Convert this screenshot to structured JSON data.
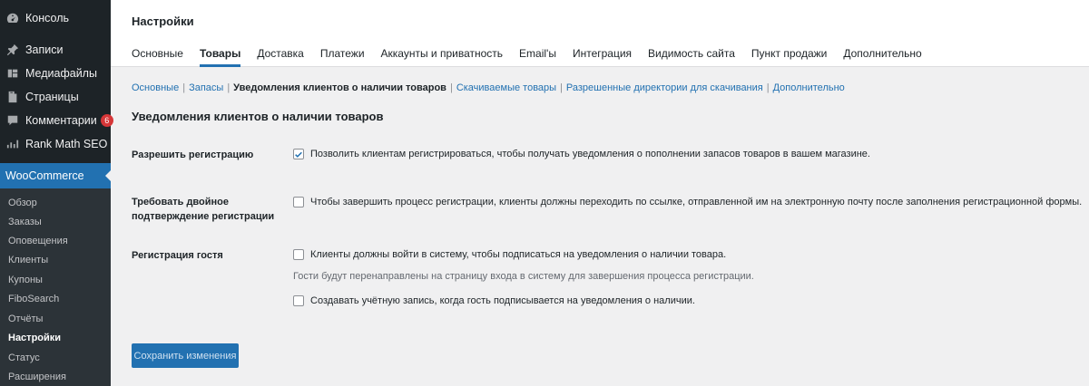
{
  "sidebar": {
    "top_items": [
      {
        "label": "Консоль",
        "icon": "dashboard-icon"
      },
      {
        "label": "Записи",
        "icon": "pin-icon"
      },
      {
        "label": "Медиафайлы",
        "icon": "media-icon"
      },
      {
        "label": "Страницы",
        "icon": "pages-icon"
      },
      {
        "label": "Комментарии",
        "icon": "comments-icon",
        "badge": "6"
      },
      {
        "label": "Rank Math SEO",
        "icon": "chart-icon"
      }
    ],
    "woocommerce": {
      "label": "WooCommerce",
      "icon": "woo-icon"
    },
    "submenu": [
      "Обзор",
      "Заказы",
      "Оповещения",
      "Клиенты",
      "Купоны",
      "FiboSearch",
      "Отчёты",
      "Настройки",
      "Статус",
      "Расширения"
    ],
    "active_submenu": "Настройки"
  },
  "header": {
    "title": "Настройки",
    "tabs": [
      "Основные",
      "Товары",
      "Доставка",
      "Платежи",
      "Аккаунты и приватность",
      "Email'ы",
      "Интеграция",
      "Видимость сайта",
      "Пункт продажи",
      "Дополнительно"
    ],
    "active_tab": "Товары"
  },
  "subsubsub": {
    "links": [
      "Основные",
      "Запасы",
      "Уведомления клиентов о наличии товаров",
      "Скачиваемые товары",
      "Разрешенные директории для скачивания",
      "Дополнительно"
    ],
    "current": "Уведомления клиентов о наличии товаров"
  },
  "section_title": "Уведомления клиентов о наличии товаров",
  "settings": {
    "allow_registration": {
      "label": "Разрешить регистрацию",
      "option": "Позволить клиентам регистрироваться, чтобы получать уведомления о пополнении запасов товаров в вашем магазине.",
      "checked": true
    },
    "double_optin": {
      "label": "Требовать двойное подтверждение регистрации",
      "option": "Чтобы завершить процесс регистрации, клиенты должны переходить по ссылке, отправленной им на электронную почту после заполнения регистрационной формы.",
      "checked": false
    },
    "guest_registration": {
      "label": "Регистрация гостя",
      "option1": "Клиенты должны войти в систему, чтобы подписаться на уведомления о наличии товара.",
      "option1_checked": false,
      "description": "Гости будут перенаправлены на страницу входа в систему для завершения процесса регистрации.",
      "option2": "Создавать учётную запись, когда гость подписывается на уведомления о наличии.",
      "option2_checked": false
    }
  },
  "save_button": "Сохранить изменения",
  "colors": {
    "accent": "#2271b1",
    "sidebar_bg": "#1d2327",
    "submenu_bg": "#2c3338",
    "badge": "#d63638"
  }
}
